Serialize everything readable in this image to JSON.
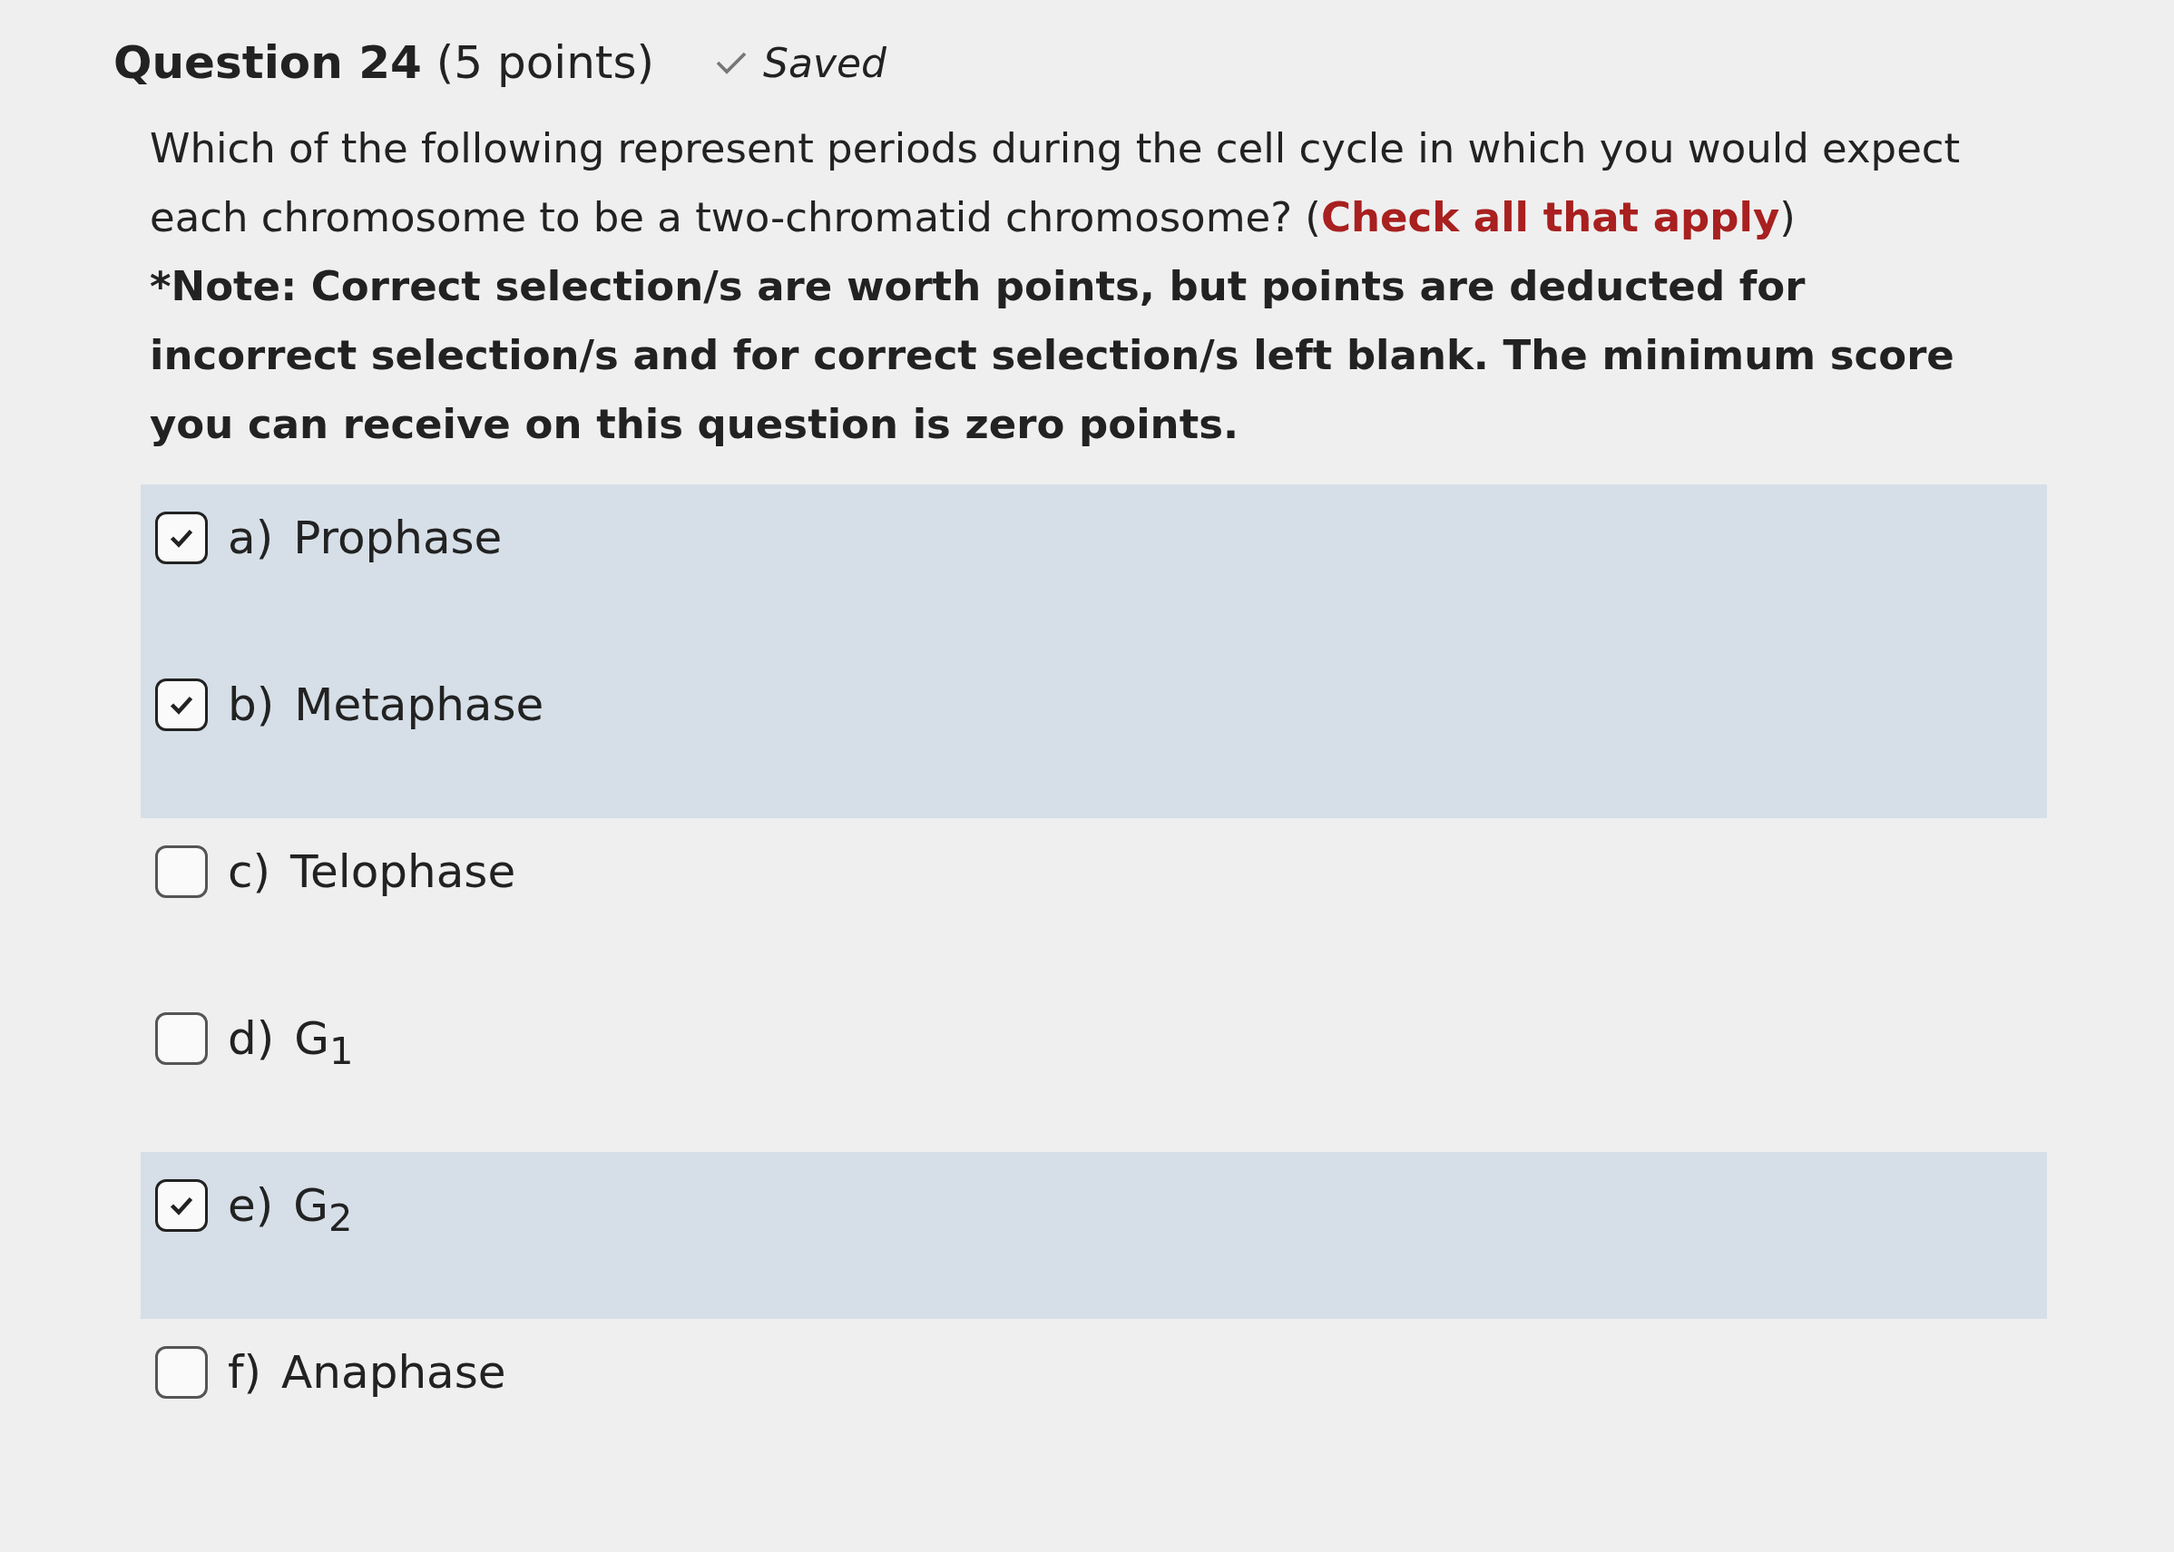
{
  "question": {
    "title": "Question 24",
    "points": "(5 points)",
    "status": "Saved"
  },
  "prompt": {
    "text": "Which of the following represent periods during the cell cycle in which you would expect each chromosome to be a two-chromatid chromosome? (",
    "emphasis": "Check all that apply",
    "after": ")",
    "note": "*Note: Correct selection/s are worth points, but points are deducted for incorrect selection/s and for correct selection/s left blank.  The minimum score you can receive on this question is zero points."
  },
  "options": [
    {
      "letter": "a)",
      "text": "Prophase",
      "checked": true
    },
    {
      "letter": "b)",
      "text": "Metaphase",
      "checked": true
    },
    {
      "letter": "c)",
      "text": "Telophase",
      "checked": false
    },
    {
      "letter": "d)",
      "text": "G$_{1}$",
      "checked": false
    },
    {
      "letter": "e)",
      "text": "G$_{2}$",
      "checked": true
    },
    {
      "letter": "f)",
      "text": "Anaphase",
      "checked": false
    }
  ]
}
